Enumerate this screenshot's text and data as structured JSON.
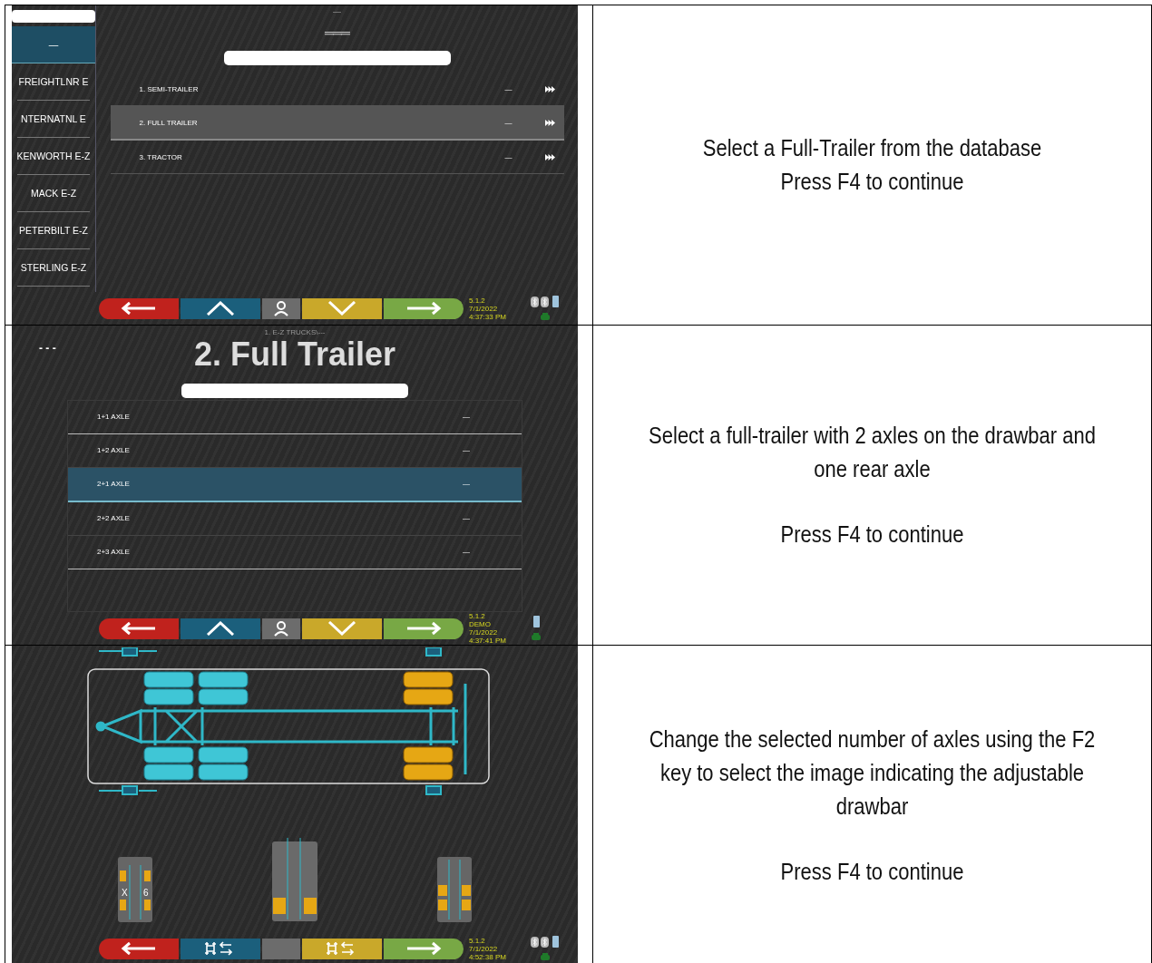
{
  "rows": [
    {
      "screen": {
        "kind": "database-menu",
        "sidebar": [
          {
            "label": "—",
            "selected": true
          },
          {
            "label": "FREIGHTLNR E",
            "selected": false
          },
          {
            "label": "NTERNATNL E",
            "selected": false
          },
          {
            "label": "KENWORTH E-Z",
            "selected": false
          },
          {
            "label": "MACK E-Z",
            "selected": false
          },
          {
            "label": "PETERBILT E-Z",
            "selected": false
          },
          {
            "label": "STERLING E-Z",
            "selected": false
          }
        ],
        "top_label": "—",
        "heading": "═══",
        "list": [
          {
            "label": "1. SEMI-TRAILER",
            "value": "—",
            "selected": false
          },
          {
            "label": "2. FULL TRAILER",
            "value": "—",
            "selected": true
          },
          {
            "label": "3. TRACTOR",
            "value": "—",
            "selected": false
          }
        ],
        "toolbar": [
          {
            "kind": "arrow-left",
            "color": "#c0221d"
          },
          {
            "kind": "chevron-up",
            "color": "#1b5f7c"
          },
          {
            "kind": "person",
            "color": "#6c6c6c"
          },
          {
            "kind": "chevron-down",
            "color": "#c9a82a"
          },
          {
            "kind": "arrow-right",
            "color": "#78a845"
          }
        ],
        "status": {
          "version": "5.1.2",
          "date": "7/1/2022",
          "time": "4:37:33 PM",
          "bluetooth": true
        }
      },
      "instructions": [
        "Select a Full-Trailer from the database\nPress F4 to continue"
      ]
    },
    {
      "screen": {
        "kind": "axle-list",
        "breadcrumb": "1. E-Z TRUCKS\\---",
        "corner_label": "- - -",
        "title": "2. Full Trailer",
        "list": [
          {
            "label": "1+1 AXLE",
            "value": "—",
            "selected": false
          },
          {
            "label": "1+2 AXLE",
            "value": "—",
            "selected": false
          },
          {
            "label": "2+1 AXLE",
            "value": "—",
            "selected": true
          },
          {
            "label": "2+2 AXLE",
            "value": "—",
            "selected": false
          },
          {
            "label": "2+3 AXLE",
            "value": "—",
            "selected": false
          }
        ],
        "toolbar": [
          {
            "kind": "arrow-left",
            "color": "#c0221d"
          },
          {
            "kind": "chevron-up",
            "color": "#1b5f7c"
          },
          {
            "kind": "person",
            "color": "#6c6c6c"
          },
          {
            "kind": "chevron-down",
            "color": "#c9a82a"
          },
          {
            "kind": "arrow-right",
            "color": "#78a845"
          }
        ],
        "status": {
          "version": "5.1.2",
          "mode": "DEMO",
          "date": "7/1/2022",
          "time": "4:37:41 PM",
          "bluetooth": false
        }
      },
      "instructions": [
        "Select a full-trailer with 2 axles on the drawbar and one rear axle",
        "Press F4 to continue"
      ]
    },
    {
      "screen": {
        "kind": "axle-diagram",
        "thumbnail_labels": [
          "X",
          "6"
        ],
        "toolbar": [
          {
            "kind": "arrow-left",
            "color": "#c0221d"
          },
          {
            "kind": "axle-swap",
            "color": "#1b5f7c"
          },
          {
            "kind": "blank",
            "color": "#6c6c6c"
          },
          {
            "kind": "axle-swap",
            "color": "#c9a82a"
          },
          {
            "kind": "arrow-right",
            "color": "#78a845"
          }
        ],
        "status": {
          "version": "5.1.2",
          "date": "7/1/2022",
          "time": "4:52:38 PM",
          "bluetooth": true
        }
      },
      "instructions": [
        "Change the selected number of axles using the F2 key to select the image indicating the adjustable drawbar",
        "Press F4 to continue"
      ]
    }
  ]
}
